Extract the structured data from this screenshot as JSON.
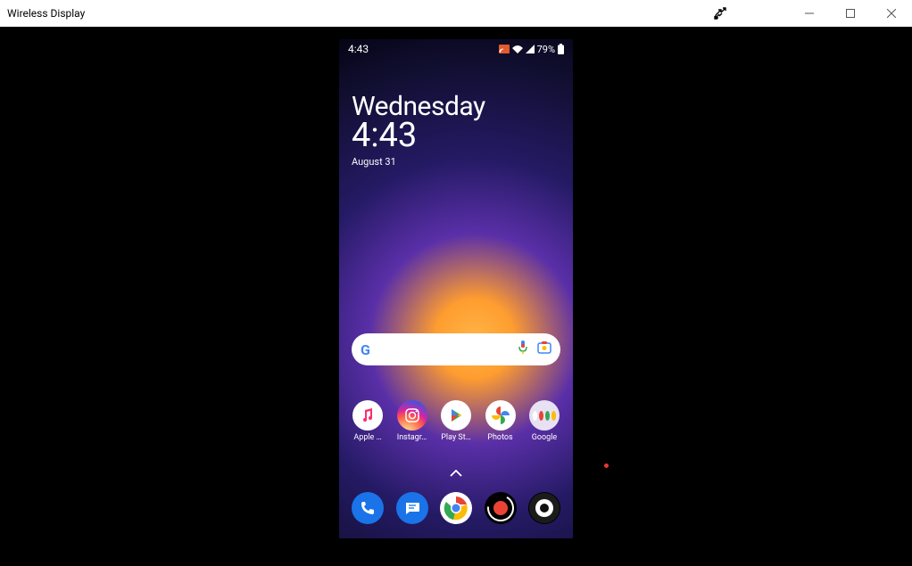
{
  "window": {
    "title": "Wireless Display"
  },
  "statusbar": {
    "time": "4:43",
    "battery": "79%"
  },
  "widget": {
    "day": "Wednesday",
    "time": "4:43",
    "date": "August 31"
  },
  "apps": [
    {
      "label": "Apple …"
    },
    {
      "label": "Instagr…"
    },
    {
      "label": "Play St…"
    },
    {
      "label": "Photos"
    },
    {
      "label": "Google"
    }
  ]
}
